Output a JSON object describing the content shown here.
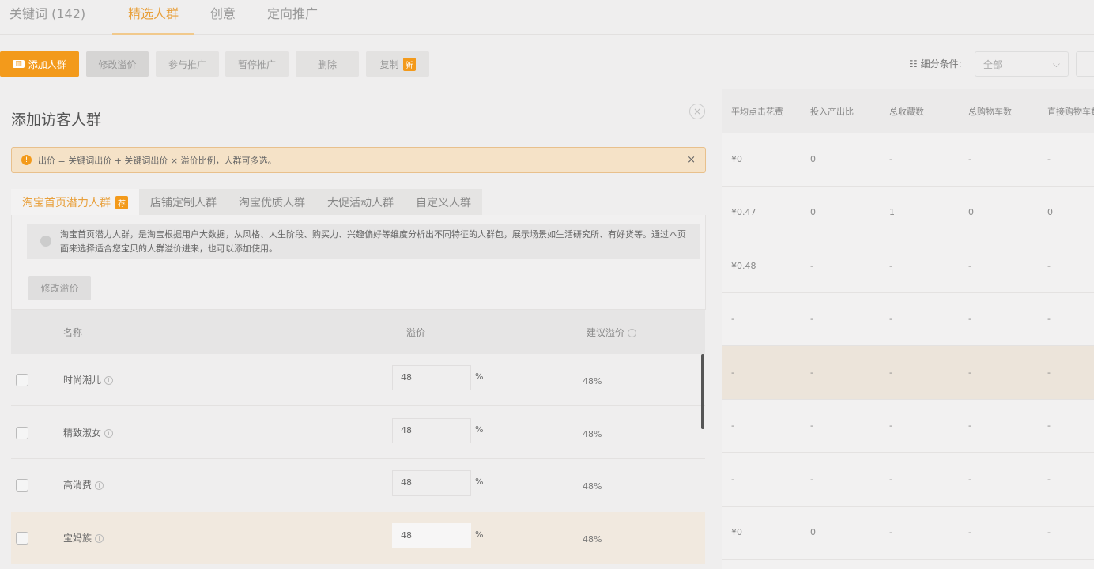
{
  "nav": {
    "tabs": [
      "关键词 (142)",
      "精选人群",
      "创意",
      "定向推广"
    ],
    "active": 1
  },
  "toolbar": {
    "buttons": [
      "添加人群",
      "修改溢价",
      "参与推广",
      "暂停推广",
      "删除",
      "复制"
    ],
    "copy_badge": "新",
    "filter_label": "细分条件:",
    "filter_value": "全部"
  },
  "panel": {
    "title": "添加访客人群",
    "close": "×",
    "alert": "出价 = 关键词出价 + 关键词出价 × 溢价比例，人群可多选。",
    "tabs": [
      {
        "label": "淘宝首页潜力人群",
        "badge": "荐"
      },
      {
        "label": "店铺定制人群"
      },
      {
        "label": "淘宝优质人群"
      },
      {
        "label": "大促活动人群"
      },
      {
        "label": "自定义人群"
      }
    ],
    "description": "淘宝首页潜力人群，是淘宝根据用户大数据，从风格、人生阶段、购买力、兴趣偏好等维度分析出不同特征的人群包，展示场景如生活研究所、有好货等。通过本页面来选择适合您宝贝的人群溢价进来，也可以添加使用。",
    "modify_button": "修改溢价",
    "columns": [
      "名称",
      "溢价",
      "建议溢价"
    ],
    "rows": [
      {
        "name": "时尚潮儿",
        "premium": "48",
        "unit": "%",
        "suggested": "48%"
      },
      {
        "name": "精致淑女",
        "premium": "48",
        "unit": "%",
        "suggested": "48%"
      },
      {
        "name": "高消费",
        "premium": "48",
        "unit": "%",
        "suggested": "48%"
      },
      {
        "name": "宝妈族",
        "premium": "48",
        "unit": "%",
        "suggested": "48%"
      }
    ]
  },
  "right_table": {
    "columns": [
      "平均点击花费",
      "投入产出比",
      "总收藏数",
      "总购物车数",
      "直接购物车数"
    ],
    "rows": [
      [
        "¥0",
        "0",
        "-",
        "-",
        "-"
      ],
      [
        "¥0.47",
        "0",
        "1",
        "0",
        "0"
      ],
      [
        "¥0.48",
        "-",
        "-",
        "-",
        "-"
      ],
      [
        "-",
        "-",
        "-",
        "-",
        "-"
      ],
      [
        "-",
        "-",
        "-",
        "-",
        "-"
      ],
      [
        "-",
        "-",
        "-",
        "-",
        "-"
      ],
      [
        "-",
        "-",
        "-",
        "-",
        "-"
      ],
      [
        "¥0",
        "0",
        "-",
        "-",
        "-"
      ]
    ]
  },
  "colors": {
    "accent": "#f39a1b",
    "alert_bg": "#f5e2c7"
  }
}
